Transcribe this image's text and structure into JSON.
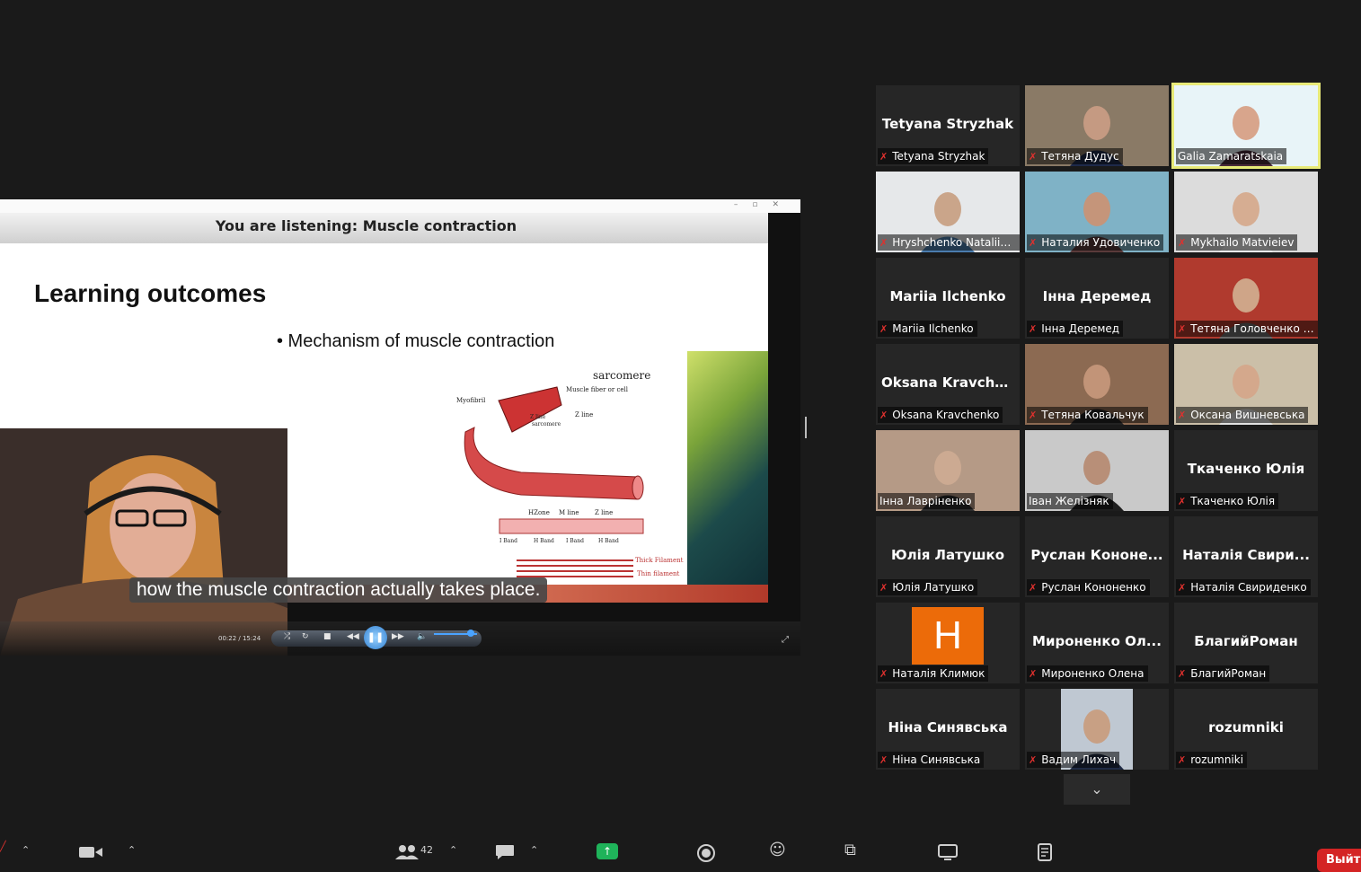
{
  "player": {
    "listening_banner": "You are listening: Muscle contraction",
    "time": "00:22 / 15:24",
    "caption": "how the muscle contraction actually takes place."
  },
  "slide": {
    "title": "Learning outcomes",
    "bullet": "• Mechanism of muscle contraction",
    "diagram_labels": {
      "sarcomere": "sarcomere",
      "myofibril": "Myofibril",
      "fiber": "Muscle fiber or cell",
      "zline1": "Z line",
      "zline_sarc": "Z line",
      "sarcomere2": "sarcomere",
      "hzone": "HZone",
      "mline": "M line",
      "zline2": "Z line",
      "iband1": "I Band",
      "hband1": "H Band",
      "iband2": "I Band",
      "hband2": "H Band",
      "thick": "Thick Filament",
      "thin": "Thin filament"
    }
  },
  "participants": [
    {
      "label": "Tetyana Stryzhak",
      "display": "Tetyana Stryzhak",
      "video": false,
      "muted": true
    },
    {
      "label": "Тетяна Дудус",
      "video": true,
      "muted": true,
      "bg": "#8a7a66",
      "face": "#c59a82",
      "shirt": "#1e2a4a"
    },
    {
      "label": "Galia Zamaratskaia",
      "video": true,
      "muted": false,
      "active": true,
      "bg": "#e8f4f8",
      "face": "#d8a58c",
      "shirt": "#4a2a3a"
    },
    {
      "label": "Hryshchenko Nataliia,...",
      "video": true,
      "muted": true,
      "bg": "#e6e8ea",
      "face": "#caa58a",
      "shirt": "#4a7cae"
    },
    {
      "label": "Наталия Удовиченко",
      "video": true,
      "muted": true,
      "bg": "#7fb2c6",
      "face": "#c5957a",
      "shirt": "#5a3a3a"
    },
    {
      "label": "Mykhailo Matvieiev",
      "video": true,
      "muted": true,
      "bg": "#dcdcdc",
      "face": "#d6ad92",
      "shirt": "#eeeeee"
    },
    {
      "label": "Mariia Ilchenko",
      "display": "Mariia Ilchenko",
      "video": false,
      "muted": true
    },
    {
      "label": "Інна Деремед",
      "display": "Інна Деремед",
      "video": false,
      "muted": true
    },
    {
      "label": "Тетяна Головченко В...",
      "video": true,
      "muted": true,
      "bg": "#b03a2e",
      "face": "#cfa588",
      "shirt": "#6a6a6a"
    },
    {
      "label": "Oksana Kravchenko",
      "display": "Oksana Kravche...",
      "video": false,
      "muted": true
    },
    {
      "label": "Тетяна Ковальчук",
      "video": true,
      "muted": true,
      "bg": "#8c6a52",
      "face": "#c29478",
      "shirt": "#222222"
    },
    {
      "label": "Оксана Вишневська",
      "video": true,
      "muted": true,
      "bg": "#cbbfa8",
      "face": "#d4a88c",
      "shirt": "#e0e0e0"
    },
    {
      "label": "Інна Лавріненко",
      "video": true,
      "muted": false,
      "bg": "#b59a86",
      "face": "#ccaa92",
      "shirt": "#2c2c2c"
    },
    {
      "label": "Іван Желізняк",
      "video": true,
      "muted": false,
      "bg": "#c9c9c9",
      "face": "#b88f78",
      "shirt": "#1e1e1e"
    },
    {
      "label": "Ткаченко Юлія",
      "display": "Ткаченко Юлія",
      "video": false,
      "muted": true
    },
    {
      "label": "Юлія Латушко",
      "display": "Юлія Латушко",
      "video": false,
      "muted": true
    },
    {
      "label": "Руслан Кононенко",
      "display": "Руслан Кононе...",
      "video": false,
      "muted": true
    },
    {
      "label": "Наталія Свириденко",
      "display": "Наталія Свири...",
      "video": false,
      "muted": true
    },
    {
      "label": "Наталія Климюк",
      "avatar_letter": "H",
      "video": false,
      "muted": true
    },
    {
      "label": "Мироненко Олена",
      "display": "Мироненко Ол...",
      "video": false,
      "muted": true
    },
    {
      "label": "БлагийРоман",
      "display": "БлагийРоман",
      "video": false,
      "muted": true
    },
    {
      "label": "Ніна Синявська",
      "display": "Ніна Синявська",
      "video": false,
      "muted": true
    },
    {
      "label": "Вадим Лихач",
      "video": true,
      "muted": true,
      "bg": "#bfc8d2",
      "face": "#c8a084",
      "shirt": "#1f2a44",
      "narrow": true
    },
    {
      "label": "rozumniki",
      "display": "rozumniki",
      "video": false,
      "muted": true
    }
  ],
  "toolbar": {
    "participants_count": "42",
    "leave": "Выйти"
  },
  "colors": {
    "active_speaker": "#e8ea78",
    "muted_icon": "#e0312e",
    "share_button": "#1fb35a",
    "leave_button": "#d42424",
    "avatar_orange": "#ec6b09"
  }
}
